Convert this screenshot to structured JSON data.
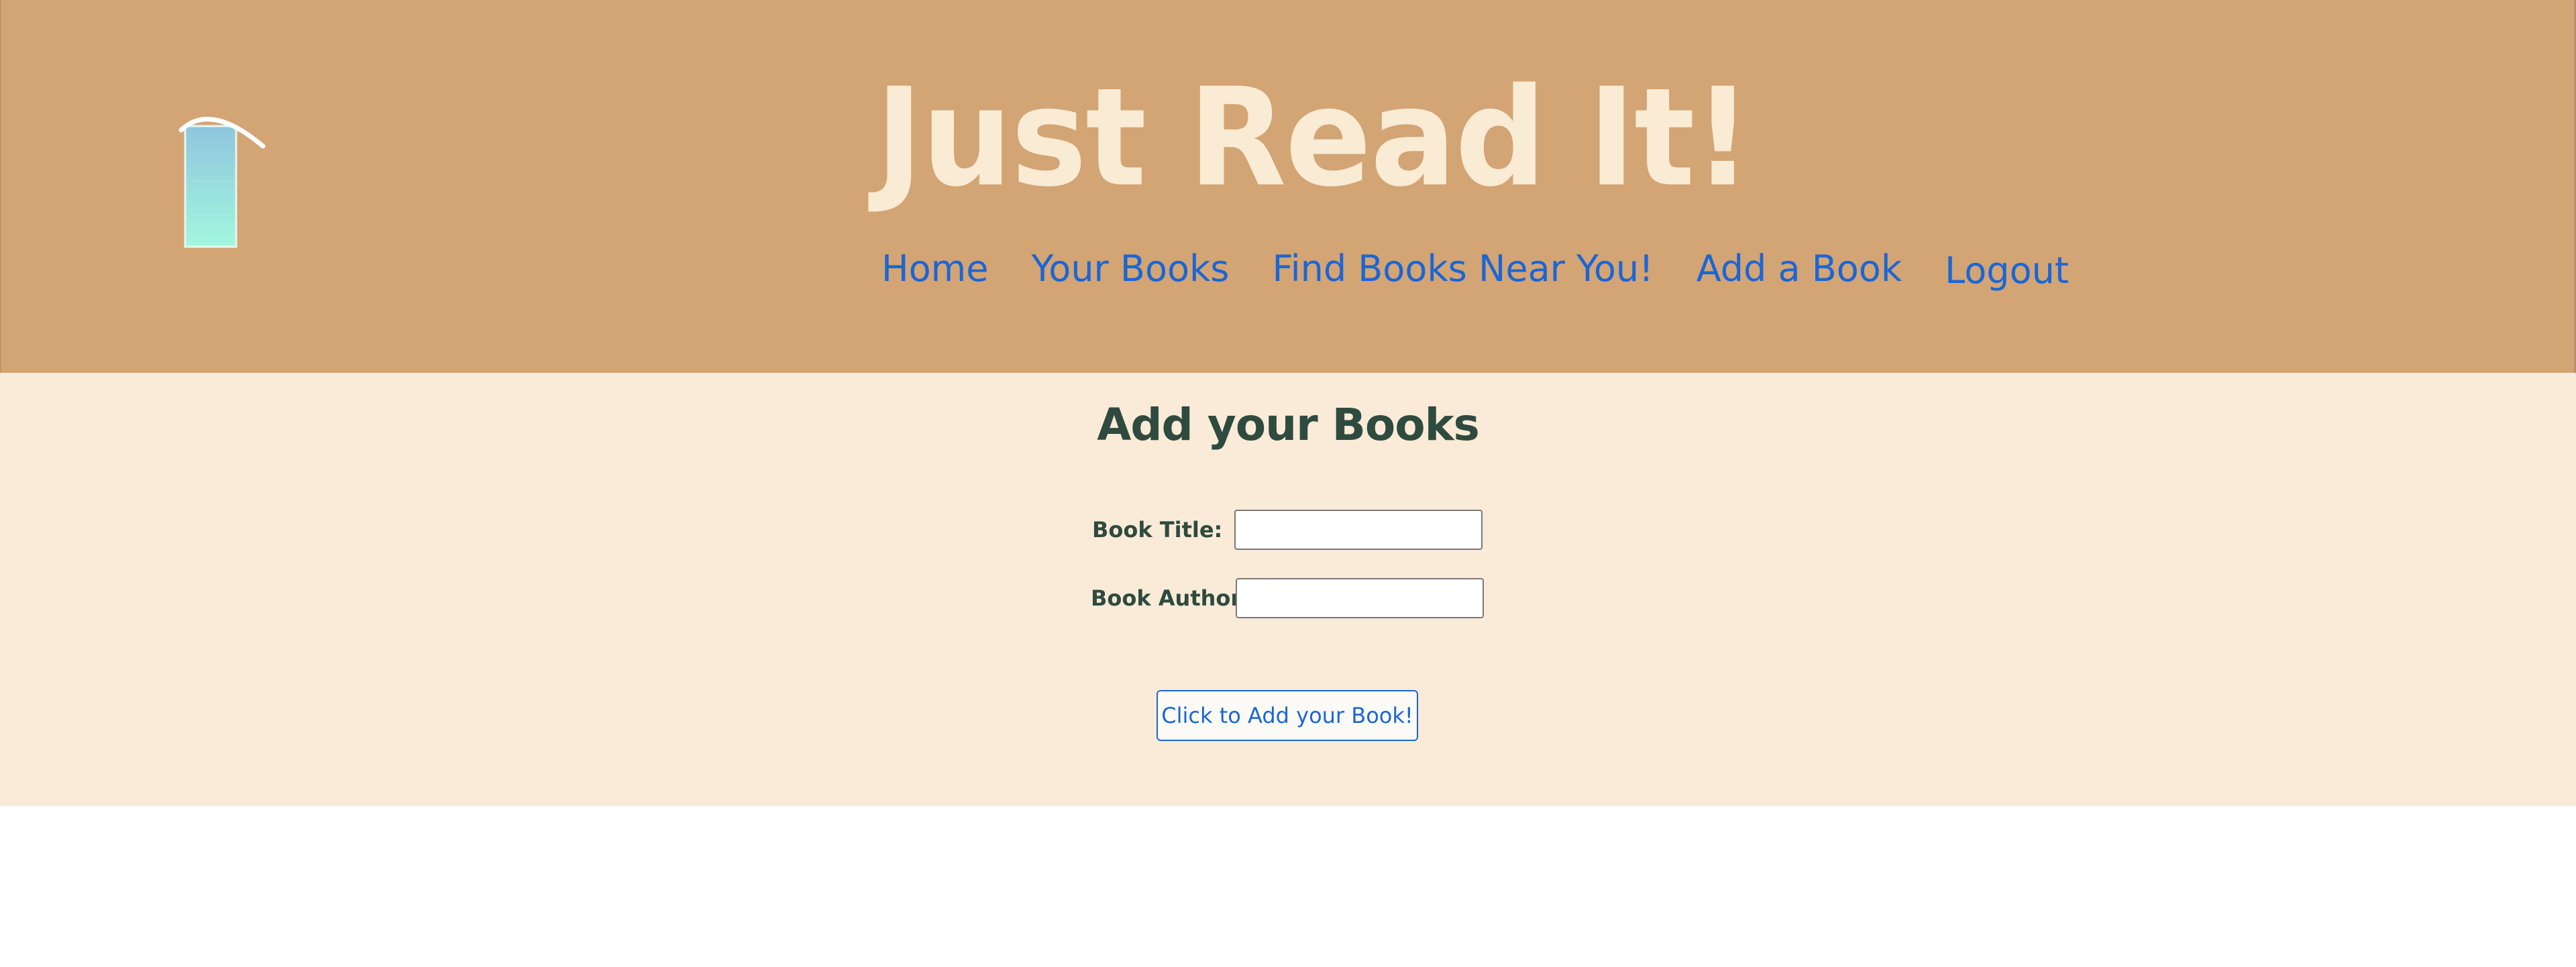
{
  "header": {
    "site_title": "Just Read It!",
    "logo_icon": "book-icon",
    "nav": {
      "home": "Home",
      "your_books": "Your Books",
      "find_books": "Find Books Near You!",
      "add_book": "Add a Book",
      "logout": "Logout"
    }
  },
  "main": {
    "heading": "Add your Books",
    "form": {
      "title_label": "Book Title:",
      "title_value": "",
      "author_label": "Book Author:",
      "author_value": "",
      "submit_label": "Click to Add your Book!"
    }
  },
  "colors": {
    "header_bg": "#d3a474",
    "title_text": "#f9ebd4",
    "content_bg": "#f9ebd7",
    "link": "#1a66d6",
    "heading_text": "#2f4a3f"
  }
}
